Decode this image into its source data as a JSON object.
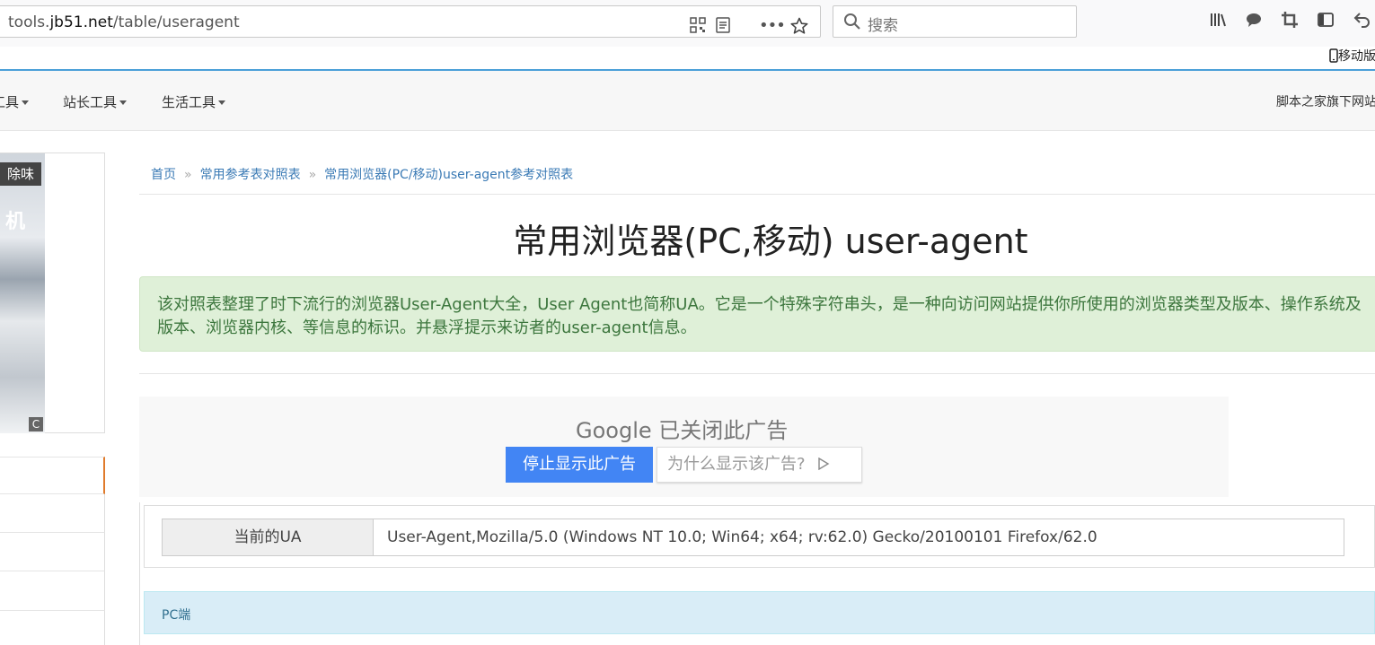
{
  "browser": {
    "url_prefix": "tools.",
    "url_host": "jb51.net",
    "url_path": "/table/useragent",
    "search_placeholder": "搜索",
    "mobile_link": "移动版"
  },
  "nav": {
    "items": [
      "工具",
      "站长工具",
      "生活工具"
    ],
    "right_text": "脚本之家旗下网站"
  },
  "left_ad": {
    "tag": "除味",
    "headline": "机",
    "corner": "C"
  },
  "breadcrumb": [
    "首页",
    "常用参考表对照表",
    "常用浏览器(PC/移动)user-agent参考对照表"
  ],
  "breadcrumb_sep": "»",
  "title": "常用浏览器(PC,移动) user-agent",
  "intro": "该对照表整理了时下流行的浏览器User-Agent大全，User Agent也简称UA。它是一个特殊字符串头，是一种向访问网站提供你所使用的浏览器类型及版本、操作系统及版本、浏览器内核、等信息的标识。并悬浮提示来访者的user-agent信息。",
  "google_ad": {
    "brand": "Google",
    "closed_text": "已关闭此广告",
    "stop_button": "停止显示此广告",
    "why_button": "为什么显示该广告?"
  },
  "ua": {
    "label": "当前的UA",
    "value": "User-Agent,Mozilla/5.0 (Windows NT 10.0; Win64; x64; rv:62.0) Gecko/20100101 Firefox/62.0"
  },
  "pc_section": {
    "label": "PC端"
  }
}
